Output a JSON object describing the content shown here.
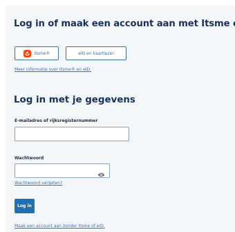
{
  "header": {
    "title": "Log in of maak een account aan met Itsme of eID"
  },
  "methods": {
    "itsme_label": "Itsme®",
    "eid_label": "eID en kaartlezer",
    "info_link": "Meer informatie over Itsme® en eID."
  },
  "form": {
    "title": "Log in met je gegevens",
    "email_label": "E-mailadres of rijksregisternummer",
    "email_value": "",
    "password_label": "Wachtwoord",
    "password_value": "",
    "forgot_link": "Wachtwoord vergeten?",
    "login_button": "Log in",
    "no_itsme_link": "Maak een account aan zonder Itsme of eID."
  },
  "colors": {
    "heading": "#16325c",
    "link": "#3b6fa8",
    "primary_button": "#1f6fb5",
    "itsme_brand": "#ff4612"
  },
  "icons": {
    "itsme": "itsme-logo-icon",
    "password_toggle": "eye-icon"
  }
}
